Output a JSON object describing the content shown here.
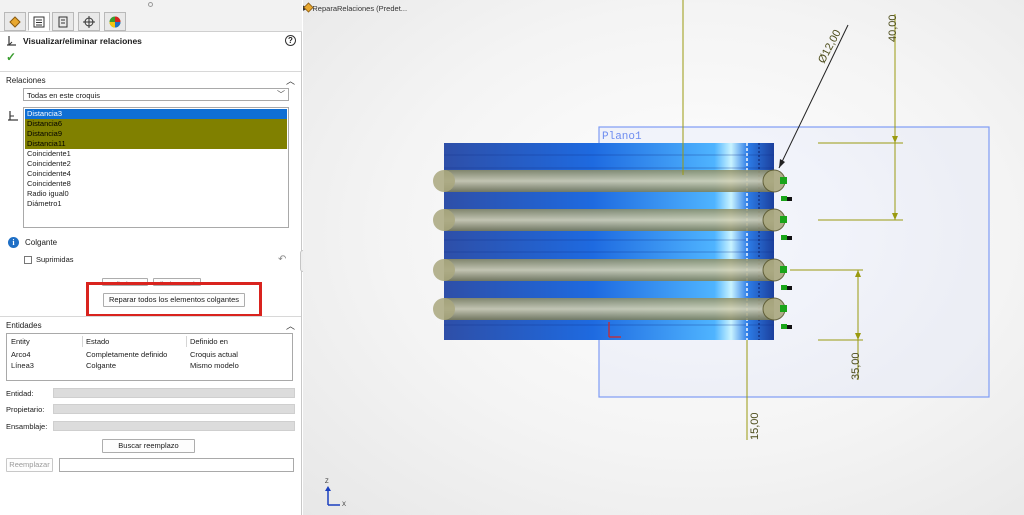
{
  "property_manager": {
    "title": "Visualizar/eliminar relaciones",
    "relations_section": {
      "label": "Relaciones",
      "filter_selected": "Todas en este croquis",
      "items": [
        {
          "label": "Distancia3"
        },
        {
          "label": "Distancia6"
        },
        {
          "label": "Distancia9"
        },
        {
          "label": "Distancia11"
        },
        {
          "label": "Coincidente1"
        },
        {
          "label": "Coincidente2"
        },
        {
          "label": "Coincidente4"
        },
        {
          "label": "Coincidente8"
        },
        {
          "label": "Radio igual0"
        },
        {
          "label": "Diámetro1"
        }
      ],
      "status_label": "Colgante",
      "suppressed_label": "Suprimidas",
      "delete_button_label": "Eliminar",
      "delete_all_button_label": "Eliminar todo",
      "repair_all_button_label": "Reparar todos los elementos colgantes"
    },
    "entities_section": {
      "label": "Entidades",
      "columns": [
        "Entity",
        "Estado",
        "Definido en"
      ],
      "rows": [
        [
          "Arco4",
          "Completamente definido",
          "Croquis actual"
        ],
        [
          "Línea3",
          "Colgante",
          "Mismo modelo"
        ]
      ],
      "entity_label": "Entidad:",
      "owner_label": "Propietario:",
      "assembly_label": "Ensamblaje:",
      "find_replacement_label": "Buscar reemplazo",
      "replace_label": "Reemplazar"
    },
    "colors": {
      "selection_blue": "#0f6fd4",
      "selection_olive": "#808000",
      "highlight_red": "#d9231e",
      "accept_green": "#3a9c2f"
    }
  },
  "graphics": {
    "tree_item": "ReparaRelaciones  (Predet...",
    "plane_label": "Plano1",
    "dimensions": {
      "diameter": "Ø12,00",
      "dim_top": "40,00",
      "dim_right": "35,00",
      "dim_bottom": "15,00"
    },
    "triad": {
      "z": "Z",
      "x": "X"
    },
    "colors": {
      "dimension": "#9a9a10",
      "plane": "#7f9cf5",
      "part_blue": "#1e5bd8"
    }
  }
}
